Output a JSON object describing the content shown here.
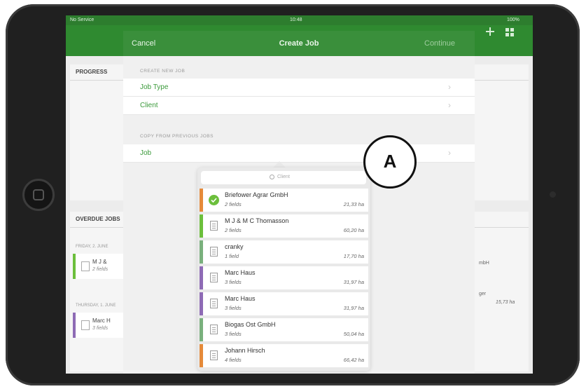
{
  "status_bar": {
    "carrier": "No Service",
    "time": "10:48",
    "battery": "100%"
  },
  "modal": {
    "cancel_label": "Cancel",
    "title": "Create Job",
    "continue_label": "Continue",
    "section_new_header": "CREATE NEW JOB",
    "job_type_label": "Job Type",
    "client_label": "Client",
    "section_copy_header": "COPY FROM PREVIOUS JOBS",
    "job_label": "Job",
    "chevron": "›"
  },
  "dashboard": {
    "progress_title": "PROGRESS",
    "jobs_title": "OVERDUE JOBS",
    "date_header_1": "FRIDAY, 2. JUNE",
    "date_header_2": "THURSDAY, 1. JUNE",
    "item1_name": "M J &",
    "item1_sub": "2 fields",
    "item2_name": "Marc H",
    "item2_sub": "3 fields",
    "right_text_1": "mbH",
    "right_text_2": "ger",
    "right_area": "15,73 ha"
  },
  "popover": {
    "search_placeholder": "Client",
    "clients": [
      {
        "name": "Briefower Agrar GmbH",
        "fields": "2 fields",
        "area": "21,33 ha",
        "color": "#e58a3a",
        "selected": true
      },
      {
        "name": "M J & M C Thomasson",
        "fields": "2 fields",
        "area": "60,20 ha",
        "color": "#6cbf3c",
        "selected": false
      },
      {
        "name": "cranky",
        "fields": "1 field",
        "area": "17,70 ha",
        "color": "#7ab07d",
        "selected": false
      },
      {
        "name": "Marc Haus",
        "fields": "3 fields",
        "area": "31,97 ha",
        "color": "#8e6bb5",
        "selected": false
      },
      {
        "name": "Marc Haus",
        "fields": "3 fields",
        "area": "31,97 ha",
        "color": "#8e6bb5",
        "selected": false
      },
      {
        "name": "Biogas Ost GmbH",
        "fields": "3 fields",
        "area": "50,04 ha",
        "color": "#7ab07d",
        "selected": false
      },
      {
        "name": "Johann Hirsch",
        "fields": "4 fields",
        "area": "66,42 ha",
        "color": "#e58a3a",
        "selected": false
      }
    ]
  },
  "annotation": {
    "label": "A"
  },
  "colors": {
    "nav_green": "#2f8a30",
    "accent_green": "#3b9a3b"
  }
}
